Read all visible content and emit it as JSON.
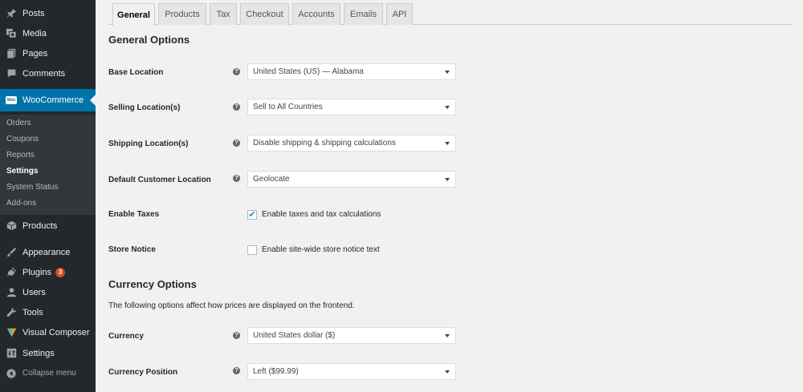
{
  "sidebar": {
    "top_items": [
      {
        "label": "Posts",
        "icon": "pushpin-icon"
      },
      {
        "label": "Media",
        "icon": "media-icon"
      },
      {
        "label": "Pages",
        "icon": "pages-icon"
      },
      {
        "label": "Comments",
        "icon": "comments-icon"
      }
    ],
    "woocommerce": {
      "label": "WooCommerce",
      "logo_text": "Woo",
      "icon": "woocommerce-icon"
    },
    "submenu": [
      "Orders",
      "Coupons",
      "Reports",
      "Settings",
      "System Status",
      "Add-ons"
    ],
    "current_submenu": "Settings",
    "bottom_items": [
      {
        "label": "Products",
        "icon": "products-icon"
      },
      {
        "label": "Appearance",
        "icon": "appearance-icon"
      },
      {
        "label": "Plugins",
        "icon": "plugins-icon",
        "badge": "3"
      },
      {
        "label": "Users",
        "icon": "users-icon"
      },
      {
        "label": "Tools",
        "icon": "tools-icon"
      },
      {
        "label": "Visual Composer",
        "icon": "visual-composer-icon"
      },
      {
        "label": "Settings",
        "icon": "settings-icon"
      }
    ],
    "collapse_label": "Collapse menu",
    "colors": {
      "background": "#23282d",
      "submenu_background": "#32373c",
      "active": "#0073aa",
      "badge": "#d54e21"
    }
  },
  "tabs": [
    {
      "label": "General",
      "active": true
    },
    {
      "label": "Products",
      "active": false
    },
    {
      "label": "Tax",
      "active": false
    },
    {
      "label": "Checkout",
      "active": false
    },
    {
      "label": "Accounts",
      "active": false
    },
    {
      "label": "Emails",
      "active": false
    },
    {
      "label": "API",
      "active": false
    }
  ],
  "general": {
    "title": "General Options",
    "base_location": {
      "label": "Base Location",
      "value": "United States (US) — Alabama"
    },
    "selling_locations": {
      "label": "Selling Location(s)",
      "value": "Sell to All Countries"
    },
    "shipping_locations": {
      "label": "Shipping Location(s)",
      "value": "Disable shipping & shipping calculations"
    },
    "default_customer_location": {
      "label": "Default Customer Location",
      "value": "Geolocate"
    },
    "enable_taxes": {
      "label": "Enable Taxes",
      "checkbox_label": "Enable taxes and tax calculations",
      "checked": true
    },
    "store_notice": {
      "label": "Store Notice",
      "checkbox_label": "Enable site-wide store notice text",
      "checked": false
    }
  },
  "currency": {
    "title": "Currency Options",
    "description": "The following options affect how prices are displayed on the frontend.",
    "currency": {
      "label": "Currency",
      "value": "United States dollar ($)"
    },
    "currency_position": {
      "label": "Currency Position",
      "value": "Left ($99.99)"
    }
  },
  "help_glyph": "?",
  "check_glyph": "✔"
}
